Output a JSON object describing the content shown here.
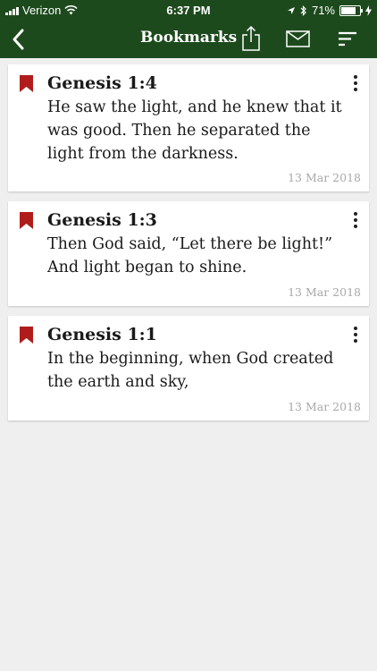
{
  "status": {
    "carrier": "Verizon",
    "time": "6:37 PM",
    "battery": "71%",
    "battery_level": 0.71
  },
  "nav": {
    "title": "Bookmarks"
  },
  "bookmarks": [
    {
      "reference": "Genesis 1:4",
      "text": "He saw the light, and he knew that it was good. Then he separated the light from the darkness.",
      "date": "13 Mar 2018"
    },
    {
      "reference": "Genesis 1:3",
      "text": "Then God said, “Let there be light!” And light began to shine.",
      "date": "13 Mar 2018"
    },
    {
      "reference": "Genesis 1:1",
      "text": "In the beginning, when God created the earth and sky,",
      "date": "13 Mar 2018"
    }
  ],
  "colors": {
    "header": "#1d4a1d",
    "bookmark": "#b01c1c",
    "background": "#efefef",
    "date": "#a8a8a8"
  }
}
